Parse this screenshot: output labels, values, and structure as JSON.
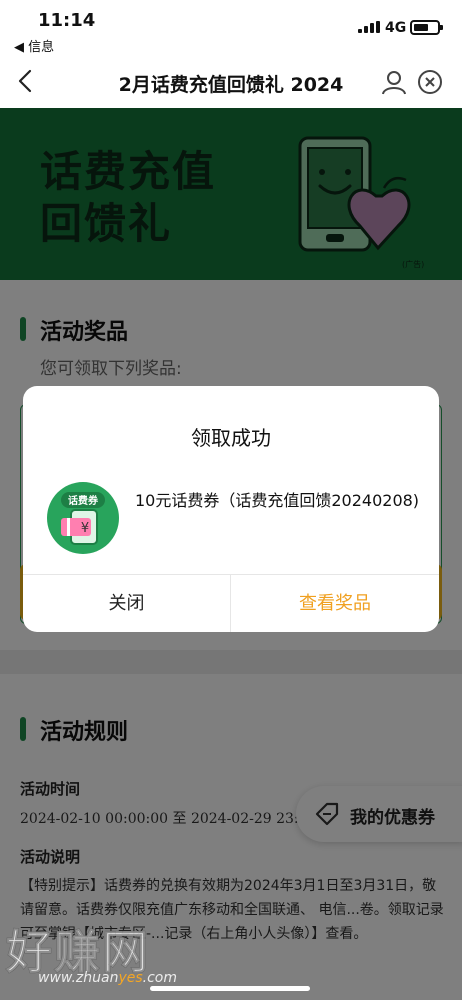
{
  "status_bar": {
    "time": "11:14",
    "back_app": "◀ 信息",
    "network": "4G"
  },
  "nav": {
    "title": "2月话费充值回馈礼 2024"
  },
  "banner": {
    "title_line1": "话费充值",
    "title_line2": "回馈礼",
    "ad_label": "广告",
    "bg_color": "#15773b"
  },
  "prizes_section": {
    "title": "活动奖品",
    "subtitle": "您可领取下列奖品:"
  },
  "rules_section": {
    "title": "活动规则",
    "time_label": "活动时间",
    "time_value": "2024-02-10 00:00:00 至 2024-02-29 23:5",
    "desc_label": "活动说明",
    "desc_text": "【特别提示】话费券的兑换有效期为2024年3月1日至3月31日，敬请留意。话费券仅限充值广东移动和全国联通、 电信...卷。领取记录可至掌银【城市专区-...记录（右上角小人头像）】查看。"
  },
  "floating_button": {
    "label": "我的优惠券"
  },
  "dialog": {
    "title": "领取成功",
    "coupon_badge": "话费券",
    "coupon_symbol": "¥",
    "prize_name": "10元话费券（话费充值回馈20240208)",
    "close_label": "关闭",
    "view_label": "查看奖品",
    "accent_color": "#f0a020"
  },
  "watermark": {
    "brand": "好赚网",
    "url_pre": "www.zhuan",
    "url_hl": "yes",
    "url_post": ".com"
  }
}
